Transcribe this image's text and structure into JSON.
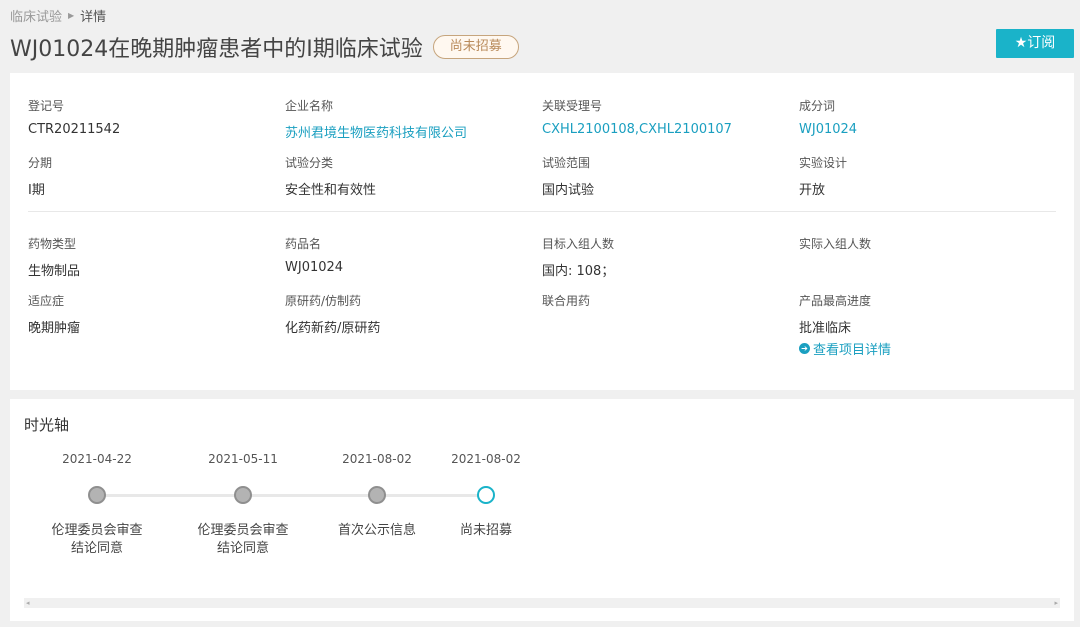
{
  "breadcrumb": {
    "parent": "临床试验",
    "current": "详情"
  },
  "header": {
    "title": "WJ01024在晚期肿瘤患者中的I期临床试验",
    "status": "尚未招募",
    "subscribe_label": "★订阅"
  },
  "fields": {
    "reg_no": {
      "label": "登记号",
      "value": "CTR20211542"
    },
    "company": {
      "label": "企业名称",
      "value": "苏州君境生物医药科技有限公司"
    },
    "accept_no": {
      "label": "关联受理号",
      "value": "CXHL2100108,CXHL2100107"
    },
    "ingredient": {
      "label": "成分词",
      "value": "WJ01024"
    },
    "phase": {
      "label": "分期",
      "value": "I期"
    },
    "category": {
      "label": "试验分类",
      "value": "安全性和有效性"
    },
    "scope": {
      "label": "试验范围",
      "value": "国内试验"
    },
    "design": {
      "label": "实验设计",
      "value": "开放"
    },
    "drug_type": {
      "label": "药物类型",
      "value": "生物制品"
    },
    "drug_name": {
      "label": "药品名",
      "value": "WJ01024"
    },
    "target_enroll": {
      "label": "目标入组人数",
      "value": "国内: 108；"
    },
    "actual_enroll": {
      "label": "实际入组人数",
      "value": ""
    },
    "indication": {
      "label": "适应症",
      "value": "晚期肿瘤"
    },
    "origin": {
      "label": "原研药/仿制药",
      "value": "化药新药/原研药"
    },
    "combo": {
      "label": "联合用药",
      "value": ""
    },
    "progress": {
      "label": "产品最高进度",
      "value": "批准临床",
      "link": "查看项目详情"
    }
  },
  "timeline": {
    "title": "时光轴",
    "events": [
      {
        "date": "2021-04-22",
        "line1": "伦理委员会审查",
        "line2": "结论同意"
      },
      {
        "date": "2021-05-11",
        "line1": "伦理委员会审查",
        "line2": "结论同意"
      },
      {
        "date": "2021-08-02",
        "line1": "首次公示信息",
        "line2": ""
      },
      {
        "date": "2021-08-02",
        "line1": "尚未招募",
        "line2": ""
      }
    ]
  }
}
